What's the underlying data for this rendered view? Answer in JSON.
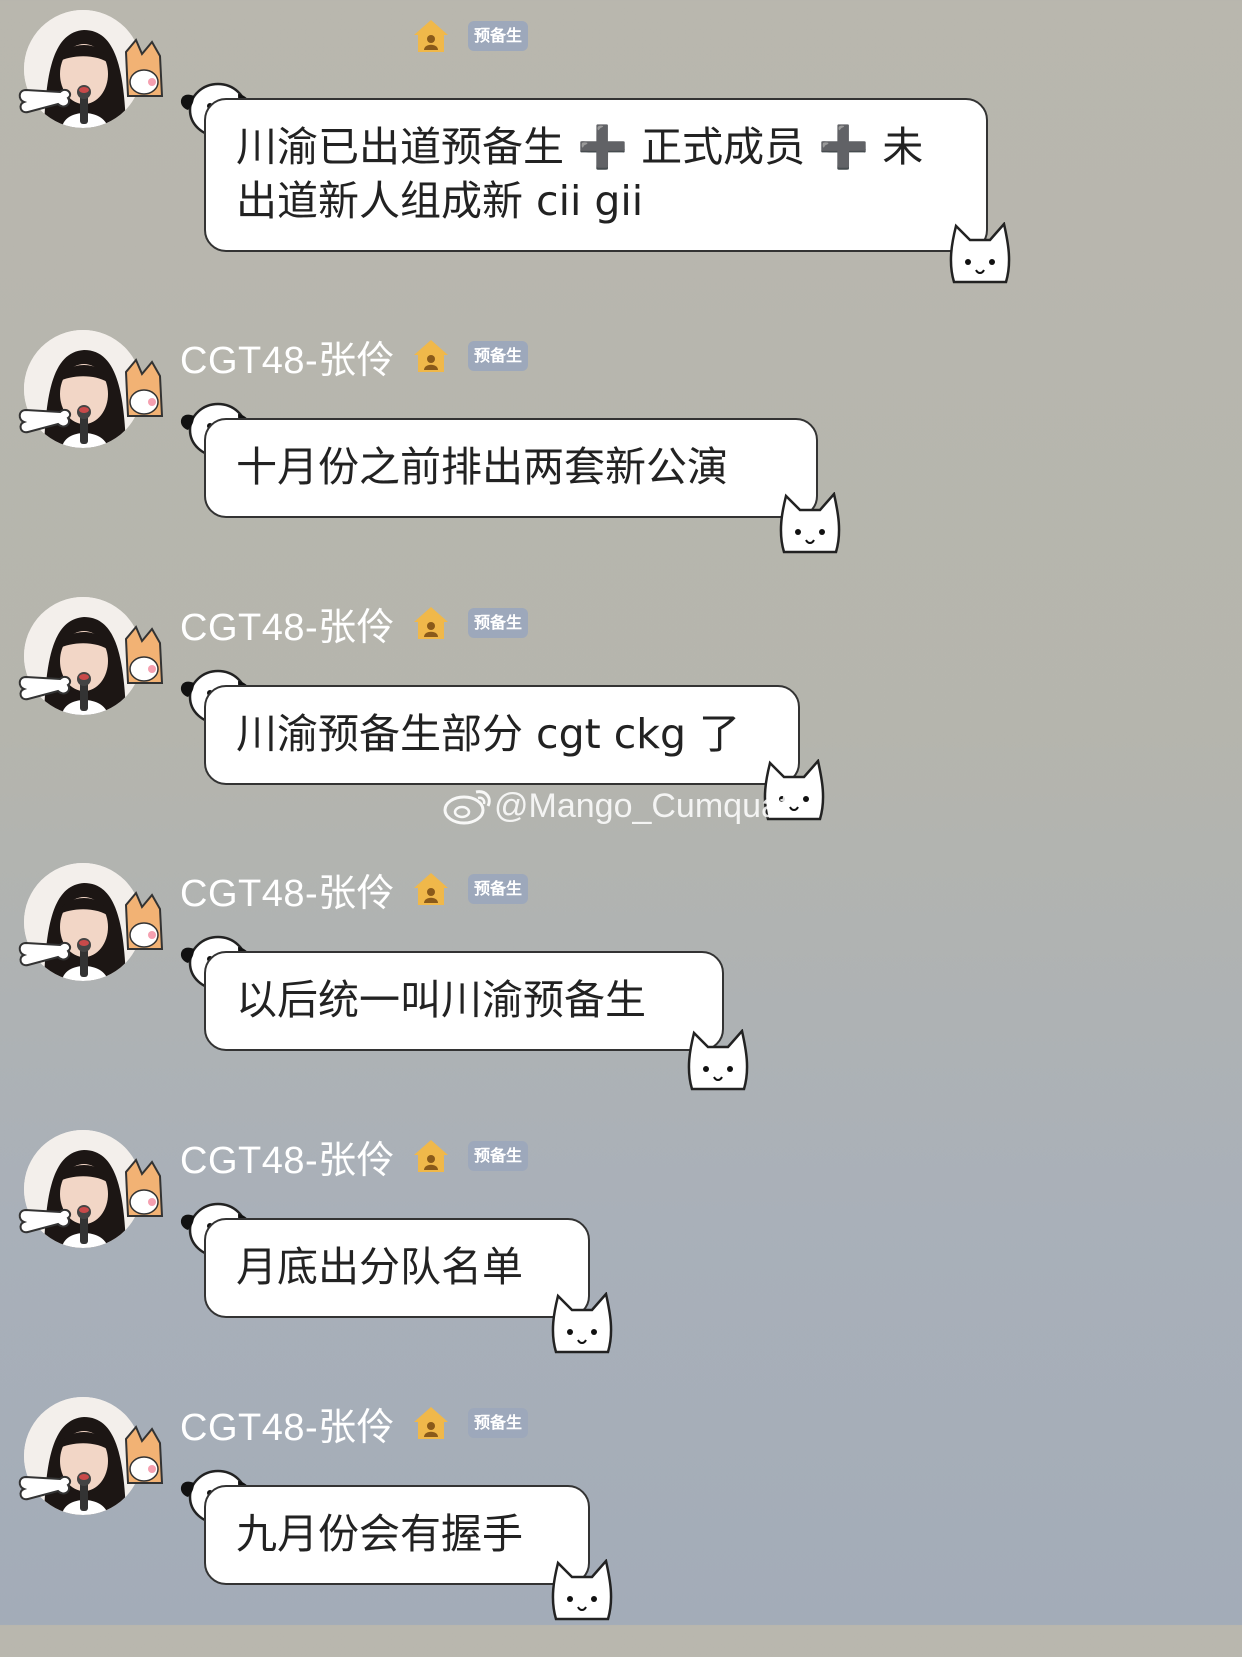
{
  "messages": [
    {
      "sender": "",
      "badge": "预备生",
      "text_lines": [
        "川渝已出道预备生 ➕ 正式成员 ➕ 未",
        "出道新人组成新 cii gii"
      ]
    },
    {
      "sender": "CGT48-张伶",
      "badge": "预备生",
      "text_lines": [
        "十月份之前排出两套新公演"
      ]
    },
    {
      "sender": "CGT48-张伶",
      "badge": "预备生",
      "text_lines": [
        "川渝预备生部分 cgt ckg 了"
      ]
    },
    {
      "sender": "CGT48-张伶",
      "badge": "预备生",
      "text_lines": [
        "以后统一叫川渝预备生"
      ]
    },
    {
      "sender": "CGT48-张伶",
      "badge": "预备生",
      "text_lines": [
        "月底出分队名单"
      ]
    },
    {
      "sender": "CGT48-张伶",
      "badge": "预备生",
      "text_lines": [
        "九月份会有握手"
      ]
    }
  ],
  "watermark": "@Mango_Cumquat",
  "icons": {
    "avatar": "avatar-girl-with-microphone",
    "corgi": "corgi-sticker-icon",
    "bone": "bone-sticker-icon",
    "house": "house-level-icon",
    "dog": "puppy-bubble-decoration-icon",
    "cat": "cat-bubble-decoration-icon",
    "weibo": "weibo-logo-icon"
  },
  "colors": {
    "badge_bg": "#9da8bb",
    "bubble_bg": "#ffffff",
    "sender_text": "#ffffff",
    "house_icon": "#f0b84a"
  }
}
